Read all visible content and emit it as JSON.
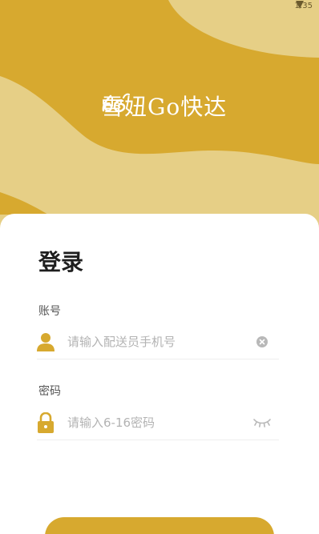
{
  "status_bar": {
    "time": "1:35",
    "signal_icon": "signal-icon"
  },
  "brand": {
    "name": "雪妞Go快达",
    "logo_icon": "snail-logo-icon"
  },
  "colors": {
    "accent": "#d7a92f",
    "accent_light": "#e6cf86",
    "placeholder": "#b3b3b3"
  },
  "login": {
    "title": "登录",
    "account": {
      "label": "账号",
      "placeholder": "请输入配送员手机号",
      "value": "",
      "lead_icon": "user-icon",
      "trail_icon": "clear-icon"
    },
    "password": {
      "label": "密码",
      "placeholder": "请输入6-16密码",
      "value": "",
      "lead_icon": "lock-icon",
      "trail_icon": "eye-closed-icon"
    },
    "submit_label": ""
  }
}
